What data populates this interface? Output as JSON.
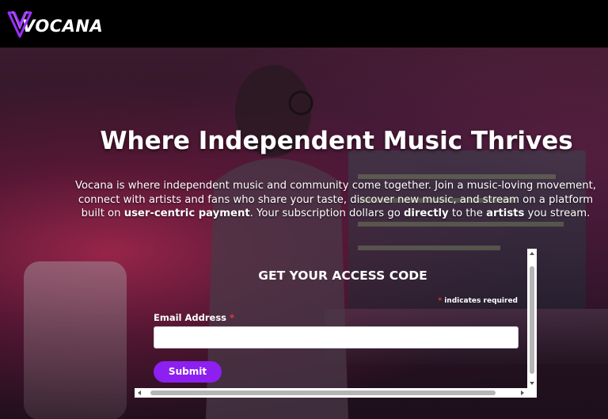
{
  "brand": {
    "name": "VOCANA",
    "accent": "#8d1ff0"
  },
  "hero": {
    "headline": "Where Independent Music Thrives",
    "intro": {
      "part1": "Vocana is where independent music and community come together. Join a music-loving movement, connect with artists and fans who share your taste, discover new music, and stream on a platform built on ",
      "bold1": "user-centric payment",
      "part2": ". Your subscription dollars go ",
      "bold2": "directly",
      "part3": " to the ",
      "bold3": "artists",
      "part4": " you stream."
    }
  },
  "form": {
    "title": "GET YOUR ACCESS CODE",
    "required_asterisk": "*",
    "required_note": "indicates required",
    "email_label": "Email Address",
    "email_value": "",
    "submit_label": "Submit"
  }
}
